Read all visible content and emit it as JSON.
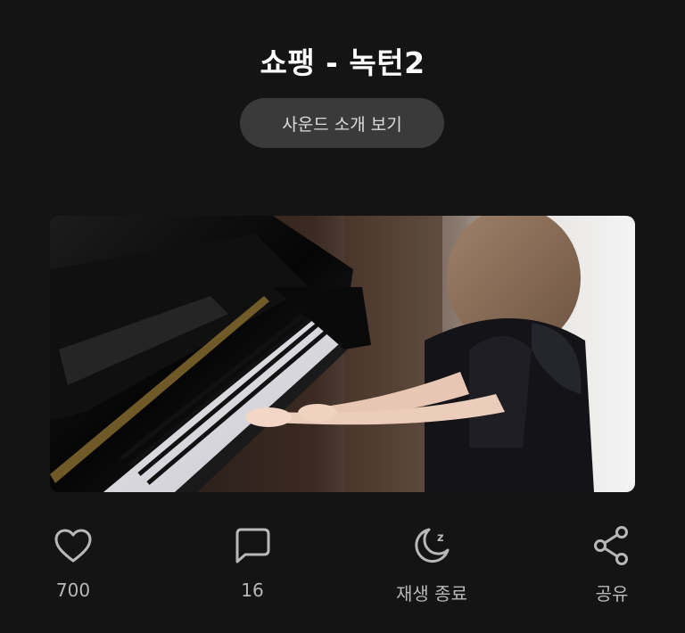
{
  "header": {
    "title": "쇼팽 - 녹턴2",
    "sound_intro_label": "사운드 소개 보기"
  },
  "media": {
    "description_icon": "video-thumbnail"
  },
  "actions": [
    {
      "icon": "heart-icon",
      "label": "700"
    },
    {
      "icon": "comment-icon",
      "label": "16"
    },
    {
      "icon": "sleep-timer-icon",
      "label": "재생 종료"
    },
    {
      "icon": "share-icon",
      "label": "공유"
    }
  ],
  "colors": {
    "background": "#141414",
    "button_bg": "#3a3a3a",
    "icon": "#b8b8b8"
  }
}
